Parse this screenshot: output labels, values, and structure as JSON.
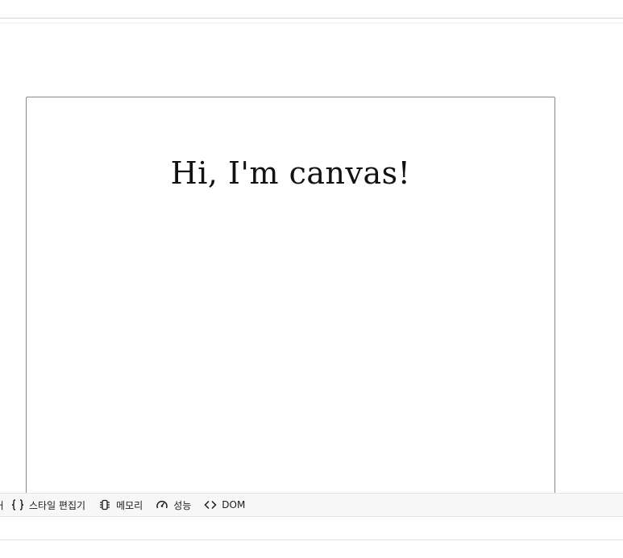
{
  "canvas": {
    "text": "Hi, I'm canvas!"
  },
  "devtools": {
    "tabs": [
      {
        "label": "ᴸ",
        "icon": "partial-tab"
      },
      {
        "label": "스타일 편집기",
        "icon": "braces-icon"
      },
      {
        "label": "메모리",
        "icon": "memory-chip-icon"
      },
      {
        "label": "성능",
        "icon": "gauge-icon"
      },
      {
        "label": "DOM",
        "icon": "code-brackets-icon"
      }
    ]
  }
}
